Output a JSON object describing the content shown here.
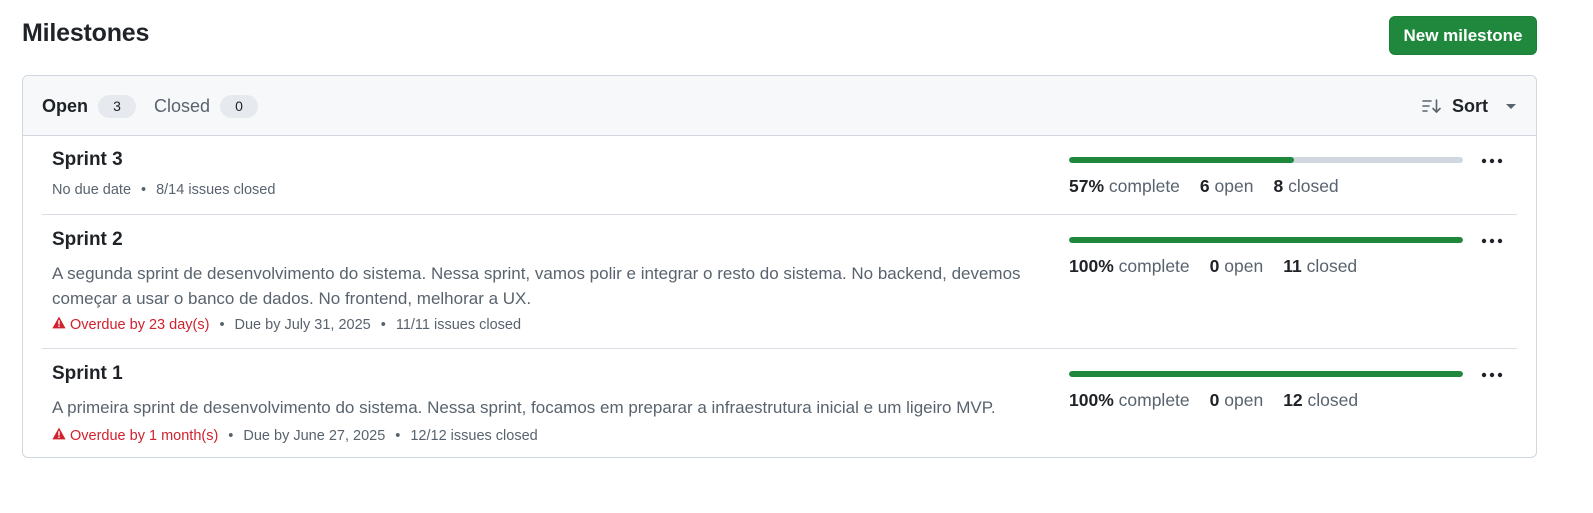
{
  "page": {
    "title": "Milestones",
    "new_button": "New milestone"
  },
  "tabs": {
    "open_label": "Open",
    "open_count": "3",
    "closed_label": "Closed",
    "closed_count": "0"
  },
  "sort": {
    "label": "Sort"
  },
  "milestones": [
    {
      "title": "Sprint 3",
      "description": "",
      "overdue": "",
      "due": "No due date",
      "issues": "8/14 issues closed",
      "progress_fraction": 0.57,
      "percent": "57%",
      "complete_label": "complete",
      "open_count": "6",
      "open_label": "open",
      "closed_count": "8",
      "closed_label": "closed"
    },
    {
      "title": "Sprint 2",
      "description": "A segunda sprint de desenvolvimento do sistema. Nessa sprint, vamos polir e integrar o resto do sistema. No backend, devemos começar a usar o banco de dados. No frontend, melhorar a UX.",
      "overdue": "Overdue by 23 day(s)",
      "due": "Due by July 31, 2025",
      "issues": "11/11 issues closed",
      "progress_fraction": 1.0,
      "percent": "100%",
      "complete_label": "complete",
      "open_count": "0",
      "open_label": "open",
      "closed_count": "11",
      "closed_label": "closed"
    },
    {
      "title": "Sprint 1",
      "description": "A primeira sprint de desenvolvimento do sistema. Nessa sprint, focamos em preparar a infraestrutura inicial e um ligeiro MVP.",
      "overdue": "Overdue by 1 month(s)",
      "due": "Due by June 27, 2025",
      "issues": "12/12 issues closed",
      "progress_fraction": 1.0,
      "percent": "100%",
      "complete_label": "complete",
      "open_count": "0",
      "open_label": "open",
      "closed_count": "12",
      "closed_label": "closed"
    }
  ],
  "colors": {
    "accent_green": "#1f883d",
    "danger_red": "#cf222e",
    "progress_track": "#d0d7de"
  },
  "icons": {
    "sort": "sort-icon",
    "caret": "triangle-down-icon",
    "kebab": "kebab-horizontal-icon",
    "alert": "alert-icon"
  }
}
